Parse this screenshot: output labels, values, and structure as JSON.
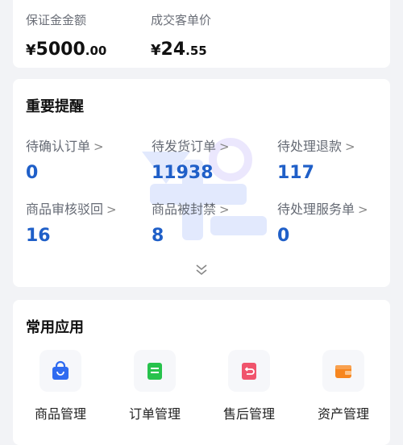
{
  "summary": {
    "deposit": {
      "label": "保证金金额",
      "currency": "¥",
      "integer": "5000",
      "decimal": ".00"
    },
    "unit_price": {
      "label": "成交客单价",
      "currency": "¥",
      "integer": "24",
      "decimal": ".55"
    }
  },
  "reminders": {
    "title": "重要提醒",
    "items": [
      {
        "label": "待确认订单",
        "value": "0"
      },
      {
        "label": "待发货订单",
        "value": "11938"
      },
      {
        "label": "待处理退款",
        "value": "117"
      },
      {
        "label": "商品审核驳回",
        "value": "16"
      },
      {
        "label": "商品被封禁",
        "value": "8"
      },
      {
        "label": "待处理服务单",
        "value": "0"
      }
    ],
    "arrow": ">"
  },
  "apps": {
    "title": "常用应用",
    "items": [
      {
        "label": "商品管理",
        "icon": "shopping-bag-icon",
        "color": "#2f6bf0"
      },
      {
        "label": "订单管理",
        "icon": "order-list-icon",
        "color": "#27c24c"
      },
      {
        "label": "售后管理",
        "icon": "return-icon",
        "color": "#f0546c"
      },
      {
        "label": "资产管理",
        "icon": "wallet-icon",
        "color": "#f7861f"
      }
    ]
  }
}
